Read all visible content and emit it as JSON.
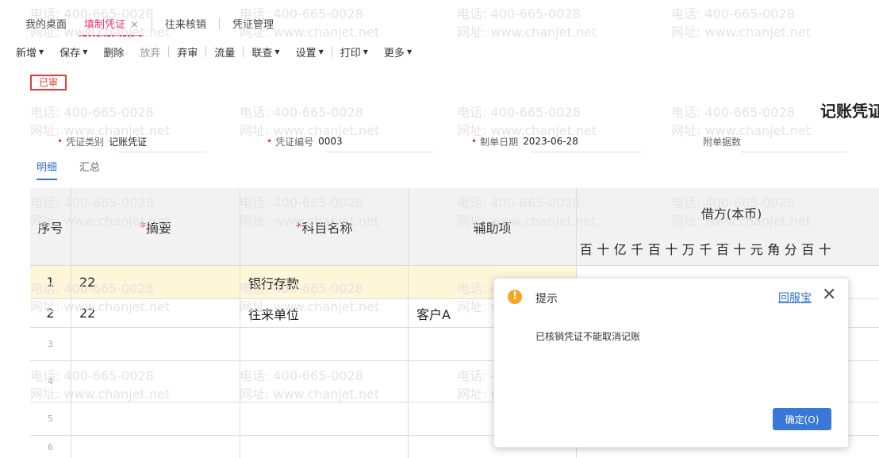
{
  "tabs": [
    {
      "label": "我的桌面"
    },
    {
      "label": "填制凭证",
      "close": "×"
    },
    {
      "label": "往来核销"
    },
    {
      "label": "凭证管理"
    }
  ],
  "toolbar": {
    "add": "新增",
    "save": "保存",
    "delete": "删除",
    "discard": "放弃",
    "unaudit": "弃审",
    "flow": "流量",
    "query": "联查",
    "settings": "设置",
    "print": "打印",
    "more": "更多"
  },
  "stamp": "已审",
  "doc_title": "记账凭证",
  "form": {
    "category_label": "凭证类别",
    "category_value": "记账凭证",
    "number_label": "凭证编号",
    "number_value": "0003",
    "date_label": "制单日期",
    "date_value": "2023-06-28",
    "attach_label": "附单据数"
  },
  "subtabs": [
    "明细",
    "汇总"
  ],
  "table": {
    "headers": {
      "seq": "序号",
      "summary": "摘要",
      "account": "科目名称",
      "aux": "辅助项",
      "debit": "借方(本币)"
    },
    "digit_units": [
      "百",
      "十",
      "亿",
      "千",
      "百",
      "十",
      "万",
      "千",
      "百",
      "十",
      "元",
      "角",
      "分",
      "百",
      "十"
    ],
    "rows": [
      {
        "seq": "1",
        "summary": "22",
        "account": "银行存款",
        "aux": ""
      },
      {
        "seq": "2",
        "summary": "22",
        "account": "往来单位",
        "aux": "客户A"
      },
      {
        "seq": "3",
        "summary": "",
        "account": "",
        "aux": ""
      },
      {
        "seq": "4",
        "summary": "",
        "account": "",
        "aux": ""
      },
      {
        "seq": "5",
        "summary": "",
        "account": "",
        "aux": ""
      },
      {
        "seq": "6",
        "summary": "",
        "account": "",
        "aux": ""
      }
    ]
  },
  "watermark": {
    "phone": "电话: 400-665-0028",
    "site": "网址: www.chanjet.net"
  },
  "dialog": {
    "title": "提示",
    "help_link": "回服宝",
    "close": "✕",
    "message": "已核销凭证不能取消记账",
    "ok_button": "确定(O)"
  },
  "colors": {
    "accent": "#e8336e",
    "link": "#2c6fd1",
    "primary_button": "#3a78d8",
    "stamp": "#e53935",
    "highlight_row": "#fdf6d9"
  }
}
